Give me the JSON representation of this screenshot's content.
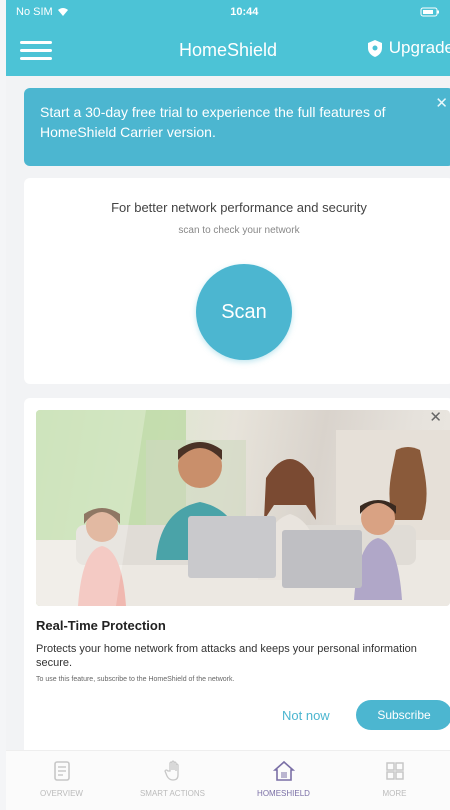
{
  "status_bar": {
    "carrier": "No SIM",
    "time": "10:44"
  },
  "app_bar": {
    "title": "HomeShield",
    "upgrade_label": "Upgrade"
  },
  "trial_banner": {
    "text": "Start a 30-day free trial to experience the full features of HomeShield Carrier version."
  },
  "scan_card": {
    "title": "For better network performance and security",
    "subtitle": "scan to check your network",
    "scan_label": "Scan"
  },
  "promo_card": {
    "title": "Real-Time Protection",
    "description": "Protects your home network from attacks and keeps your personal information secure.",
    "note": "To use this feature, subscribe to the HomeShield of the network.",
    "not_now_label": "Not now",
    "subscribe_label": "Subscribe"
  },
  "tab_bar": {
    "items": [
      {
        "label": "OVERVIEW",
        "icon": "document-icon"
      },
      {
        "label": "SMART ACTIONS",
        "icon": "hand-icon"
      },
      {
        "label": "HOMESHIELD",
        "icon": "house-icon",
        "active": true
      },
      {
        "label": "MORE",
        "icon": "grid-icon"
      }
    ]
  },
  "colors": {
    "accent": "#4cb6d0",
    "header": "#4cc3d6",
    "active_tab": "#7a6fa6"
  }
}
